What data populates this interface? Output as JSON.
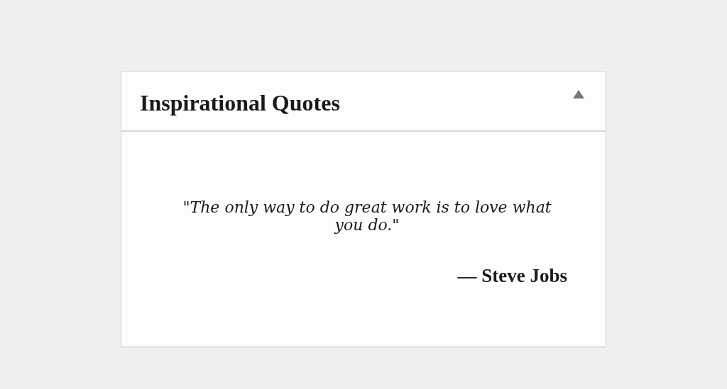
{
  "widget": {
    "title": "Inspirational Quotes",
    "expanded": true,
    "quote": "\"The only way to do great work is to love what you do.\"",
    "author": "— Steve Jobs"
  }
}
